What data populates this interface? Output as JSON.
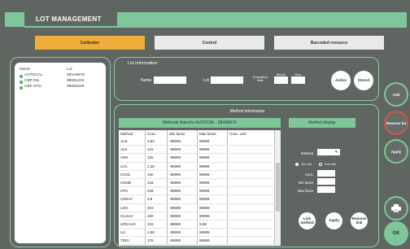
{
  "app": {
    "title": "LOT MANAGEMENT"
  },
  "tabs": [
    {
      "label": "Calibrator",
      "active": true
    },
    {
      "label": "Control",
      "active": false
    },
    {
      "label": "Barcoded resource",
      "active": false
    }
  ],
  "lot_list": {
    "headers": [
      "Name",
      "Lot"
    ],
    "rows": [
      {
        "name": "AUTOCAL",
        "lot": "08VA8676"
      },
      {
        "name": "CBP DIL",
        "lot": "08081234"
      },
      {
        "name": "CBP STD",
        "lot": "08053229"
      }
    ]
  },
  "lot_info": {
    "title": "Lot information",
    "name_label": "Name",
    "lot_label": "Lot",
    "expiration_label": "Expiration date",
    "month_label": "Month",
    "year_label": "Year",
    "active_button": "Active",
    "stored_button": "Stored"
  },
  "method_info": {
    "title": "Method information",
    "linked_header": "Methods linked to AUTOCAL : 08VA8676",
    "display_header": "Method display",
    "columns": [
      "Method",
      "Conc.",
      "Min factor",
      "Max factor",
      "Conc. unit"
    ],
    "rows": [
      [
        "ALB",
        "3,82",
        "-99999",
        "99999",
        ""
      ],
      [
        "ALK",
        "415",
        "-99999",
        "99999",
        ""
      ],
      [
        "AMY",
        "325",
        "-99999",
        "99999",
        ""
      ],
      [
        "CAL",
        "2,38",
        "-99999",
        "99999",
        ""
      ],
      [
        "CHOL",
        "160",
        "-99999",
        "99999",
        ""
      ],
      [
        "CKMB",
        "318",
        "-99999",
        "99999",
        ""
      ],
      [
        "CPK",
        "349",
        "-99999",
        "99999",
        ""
      ],
      [
        "CREAT",
        "3,8",
        "-99999",
        "99999",
        ""
      ],
      [
        "LDH",
        "403",
        "-99999",
        "99999",
        ""
      ],
      [
        "GLUUV",
        "200",
        "-99999",
        "99999",
        ""
      ],
      [
        "UREAUV",
        "103",
        "-99999",
        "9,99",
        ""
      ],
      [
        "UA",
        "4,98",
        "-99999",
        "99999",
        ""
      ],
      [
        "TRIG",
        "178",
        "-99999",
        "99999",
        ""
      ]
    ],
    "display": {
      "method_label": "Method",
      "radio_first": "1st unit",
      "radio_second": "2nd unit",
      "conc_label": "Conc.",
      "min_label": "Min factor",
      "max_label": "Max factor",
      "link_button": "Link method",
      "apply_button": "Apply",
      "remove_button": "Remove link"
    }
  },
  "side_buttons": {
    "add": "Add",
    "remove": "Remove lot",
    "apply": "Apply",
    "ok": "OK"
  },
  "colors": {
    "background": "#5f6662",
    "accent": "#7fc79a",
    "tab_active": "#f0ad3b",
    "remove_border": "#d9534f"
  }
}
